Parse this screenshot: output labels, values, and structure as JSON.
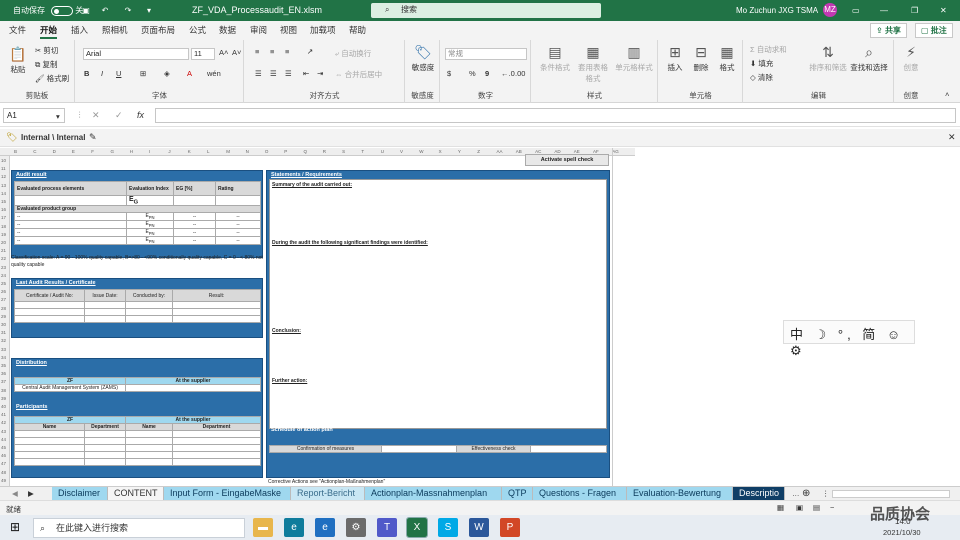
{
  "title_bar": {
    "autosave_label": "自动保存",
    "autosave_state": "关",
    "filename": "ZF_VDA_Processaudit_EN.xlsm",
    "search_placeholder": "搜索",
    "user_name": "Mo Zuchun JXG TSMA",
    "user_initials": "MZ"
  },
  "ribbon_tabs": [
    "文件",
    "开始",
    "插入",
    "照相机",
    "页面布局",
    "公式",
    "数据",
    "审阅",
    "视图",
    "加载项",
    "帮助"
  ],
  "ribbon_right": {
    "share": "共享",
    "comments": "批注"
  },
  "clipboard": {
    "paste": "粘贴",
    "cut": "剪切",
    "copy": "复制",
    "format_painter": "格式刷",
    "label": "剪贴板"
  },
  "font": {
    "name": "Arial",
    "size": "11",
    "label": "字体"
  },
  "alignment": {
    "wrap": "自动换行",
    "merge": "合并后居中",
    "label": "对齐方式"
  },
  "sensitivity": {
    "button": "敏感度",
    "label": "敏感度"
  },
  "number": {
    "format": "常规",
    "label": "数字"
  },
  "styles": {
    "conditional": "条件格式",
    "table": "套用表格格式",
    "cell": "单元格样式",
    "label": "样式"
  },
  "cells": {
    "insert": "插入",
    "delete": "删除",
    "format": "格式",
    "label": "单元格"
  },
  "editing": {
    "autosum": "自动求和",
    "fill": "填充",
    "clear": "清除",
    "sort": "排序和筛选",
    "find": "查找和选择",
    "label": "编辑"
  },
  "creative": {
    "button": "创意",
    "label": "创意"
  },
  "formula_bar": {
    "name_box": "A1",
    "fx": "fx",
    "content": ""
  },
  "info_bar": {
    "label": "Internal \\ Internal"
  },
  "col_headers": [
    "B",
    "C",
    "D",
    "E",
    "F",
    "G",
    "H",
    "I",
    "J",
    "K",
    "L",
    "M",
    "N",
    "O",
    "P",
    "Q",
    "R",
    "S",
    "T",
    "U",
    "V",
    "W",
    "X",
    "Y",
    "Z",
    "AA",
    "AB",
    "AC",
    "AD",
    "AE",
    "AF",
    "AG"
  ],
  "row_numbers": [
    "10",
    "11",
    "12",
    "13",
    "14",
    "15",
    "16",
    "17",
    "18",
    "19",
    "20",
    "21",
    "22",
    "23",
    "24",
    "25",
    "26",
    "27",
    "28",
    "29",
    "30",
    "31",
    "32",
    "33",
    "34",
    "35",
    "36",
    "37",
    "38",
    "39",
    "40",
    "41",
    "42",
    "43",
    "44",
    "45",
    "46",
    "47",
    "48",
    "49"
  ],
  "audit_result": {
    "title": "Audit result",
    "headers": [
      "Evaluated process elements",
      "Evaluation Index",
      "EG [%]",
      "Rating"
    ],
    "eg_symbol": "E",
    "eg_sub": "G",
    "product_group_label": "Evaluated product group",
    "rows": [
      {
        "label": "--",
        "index": "E",
        "sub": "PN",
        "eg": "--",
        "rating": "--"
      },
      {
        "label": "--",
        "index": "E",
        "sub": "PN",
        "eg": "--",
        "rating": "--"
      },
      {
        "label": "--",
        "index": "E",
        "sub": "PN",
        "eg": "--",
        "rating": "--"
      },
      {
        "label": "--",
        "index": "E",
        "sub": "PN",
        "eg": "--",
        "rating": "--"
      }
    ],
    "note": "Classification scale: A = 90 - 100% quality capable, B=>80 - <90% conditionally quality capable, C = 0 - < 80% not quality capable"
  },
  "last_audit": {
    "title": "Last Audit Results  / Certificate",
    "headers": [
      "Certificate / Audit No:",
      "Issue Date:",
      "Conducted by:",
      "Result:"
    ]
  },
  "distribution": {
    "title": "Distribution",
    "zf_header": "ZF",
    "supplier_header": "At the supplier",
    "system": "Central Audit Management System (ZAMS)"
  },
  "participants": {
    "title": "Participants",
    "zf_header": "ZF",
    "supplier_header": "At the supplier",
    "cols": [
      "Name",
      "Department",
      "Name",
      "Department"
    ]
  },
  "statements": {
    "title": "Statements / Requirements",
    "summary": "Summary of the audit carried out:",
    "findings": "During the audit the following significant findings were identified:",
    "conclusion": "Conclusion:",
    "further": "Further action:"
  },
  "schedule": {
    "title": "Schedule of action plan",
    "confirmation": "Confirmation of measures",
    "effectiveness": "Effectiveness check"
  },
  "corrective_note": "Corrective Actions see \"Actionplan-Maßnahmenplan\"",
  "spell_check": "Activate spell check",
  "ime": "中 ☽ °, 简 ☺ ⚙",
  "sheet_tabs": [
    "Disclaimer",
    "CONTENT",
    "Input Form - EingabeMaske",
    "Report-Bericht",
    "Actionplan-Massnahmenplan",
    "QTP",
    "Questions - Fragen",
    "Evaluation-Bewertung",
    "Descriptio"
  ],
  "status": {
    "ready": "就绪"
  },
  "taskbar": {
    "search_placeholder": "在此键入进行搜索",
    "time": "14:0",
    "date": "2021/10/30"
  },
  "watermark": "品质协会",
  "colors": {
    "excel_green": "#217346",
    "panel_blue": "#2b6ea8",
    "supplier_cyan": "#9fd8ef"
  }
}
